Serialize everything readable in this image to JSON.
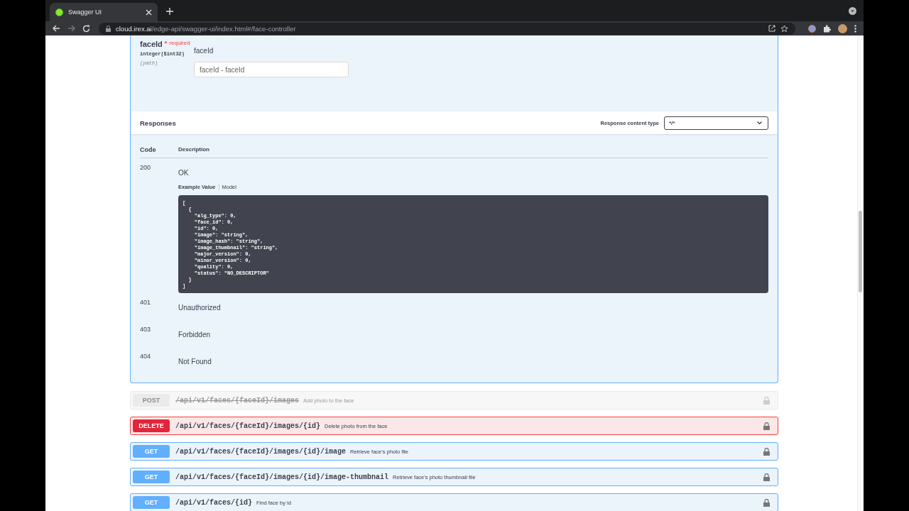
{
  "browser": {
    "tab_title": "Swagger UI",
    "url_host": "cloud.irex.ai",
    "url_path": "/edge-api/swagger-ui/index.html#/face-controller"
  },
  "parameter": {
    "name": "faceId",
    "required_mark": "*",
    "required_label": "required",
    "type": "integer($int32)",
    "location": "(path)",
    "description": "faceId",
    "placeholder": "faceId - faceId"
  },
  "responses": {
    "title": "Responses",
    "content_type_label": "Response content type",
    "content_type": "*/*",
    "columns": [
      "Code",
      "Description"
    ],
    "rows": [
      {
        "code": "200",
        "description": "OK",
        "example_tabs": [
          {
            "label": "Example Value",
            "selected": true
          },
          {
            "label": "Model",
            "selected": false
          }
        ],
        "example": "[\n  {\n    \"alg_type\": 0,\n    \"face_id\": 0,\n    \"id\": 0,\n    \"image\": \"string\",\n    \"image_hash\": \"string\",\n    \"image_thumbnail\": \"string\",\n    \"major_version\": 0,\n    \"minor_version\": 0,\n    \"quality\": 0,\n    \"status\": \"NO_DESCRIPTOR\"\n  }\n]"
      },
      {
        "code": "401",
        "description": "Unauthorized"
      },
      {
        "code": "403",
        "description": "Forbidden"
      },
      {
        "code": "404",
        "description": "Not Found"
      }
    ]
  },
  "operations": [
    {
      "method": "POST",
      "kind": "post",
      "deprecated": true,
      "path": "/api/v1/faces/{faceId}/images",
      "summary": "Add photo to the face"
    },
    {
      "method": "DELETE",
      "kind": "delete",
      "deprecated": false,
      "path": "/api/v1/faces/{faceId}/images/{id}",
      "summary": "Delete photo from the face"
    },
    {
      "method": "GET",
      "kind": "get",
      "deprecated": false,
      "path": "/api/v1/faces/{faceId}/images/{id}/image",
      "summary": "Retrieve face's photo file"
    },
    {
      "method": "GET",
      "kind": "get",
      "deprecated": false,
      "path": "/api/v1/faces/{faceId}/images/{id}/image-thumbnail",
      "summary": "Retrieve face's photo thumbnail file"
    },
    {
      "method": "GET",
      "kind": "get",
      "deprecated": false,
      "path": "/api/v1/faces/{id}",
      "summary": "Find face by id"
    }
  ]
}
